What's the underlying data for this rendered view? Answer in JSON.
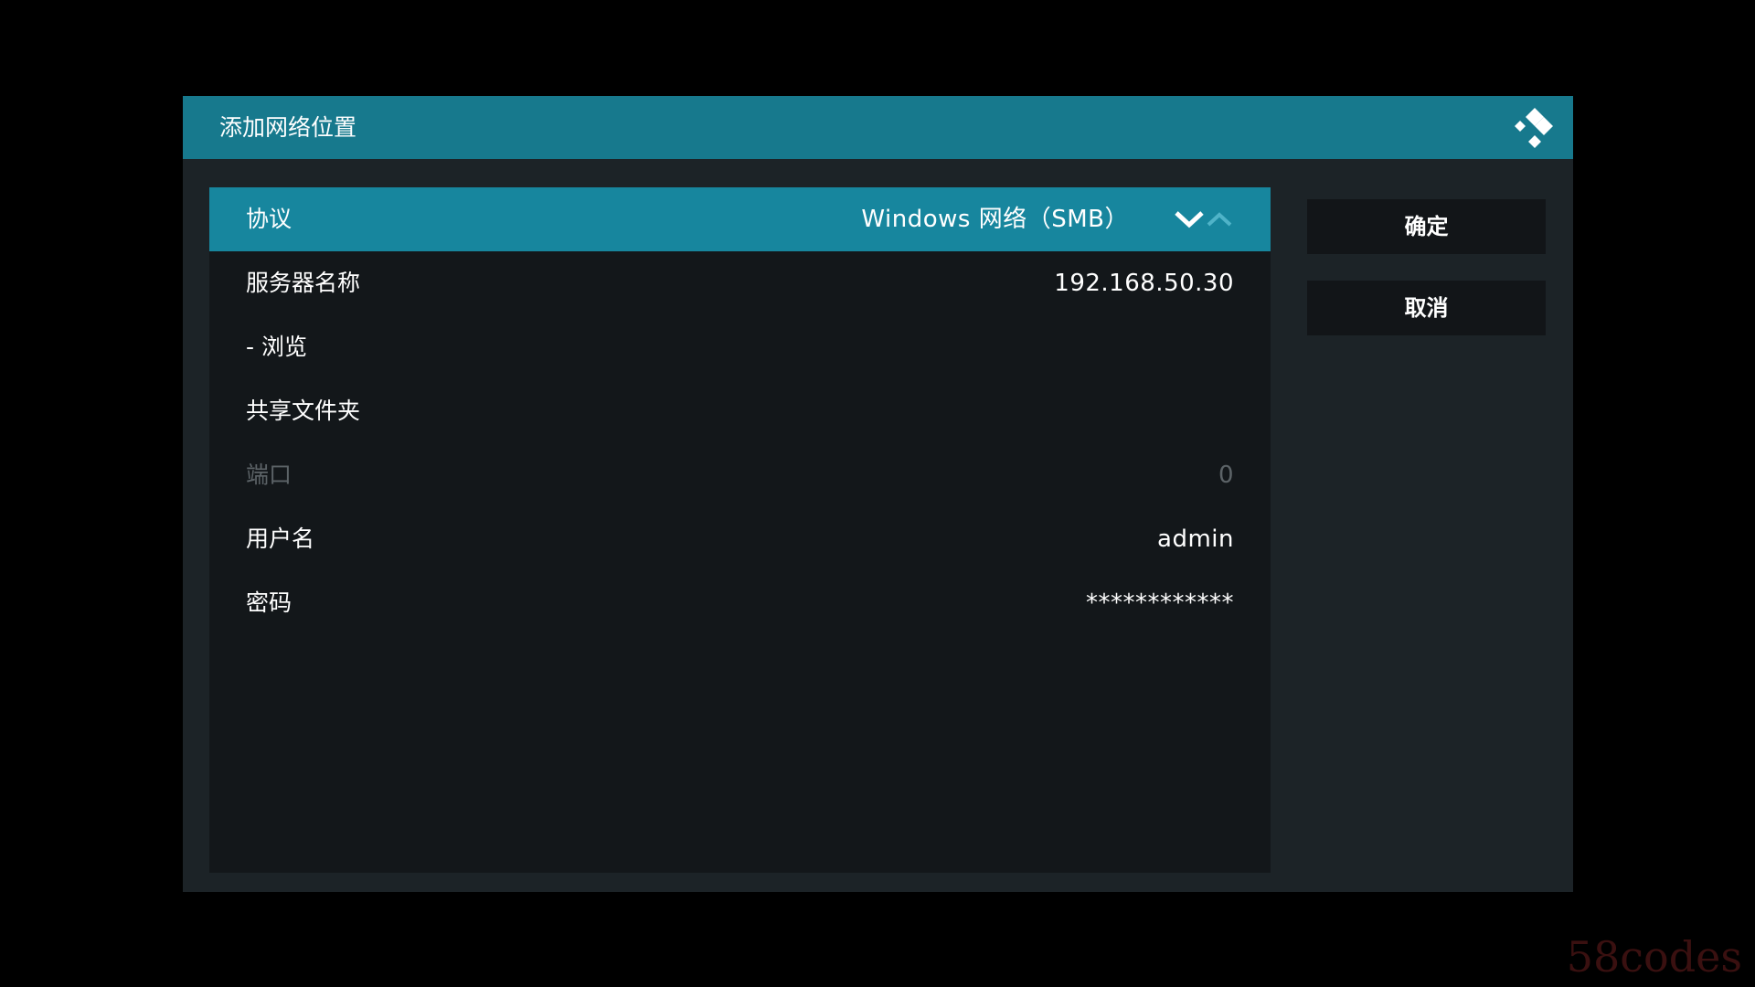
{
  "dialog": {
    "title": "添加网络位置",
    "logo_icon": "kodi-logo-icon"
  },
  "fields": [
    {
      "label": "协议",
      "value": "Windows 网络（SMB）",
      "focused": true,
      "disabled": false,
      "spinner": true
    },
    {
      "label": "服务器名称",
      "value": "192.168.50.30",
      "focused": false,
      "disabled": false
    },
    {
      "label": "- 浏览",
      "value": "",
      "focused": false,
      "disabled": false
    },
    {
      "label": "共享文件夹",
      "value": "",
      "focused": false,
      "disabled": false
    },
    {
      "label": "端口",
      "value": "0",
      "focused": false,
      "disabled": true
    },
    {
      "label": "用户名",
      "value": "admin",
      "focused": false,
      "disabled": false
    },
    {
      "label": "密码",
      "value": "************",
      "focused": false,
      "disabled": false
    }
  ],
  "buttons": {
    "ok_label": "确定",
    "cancel_label": "取消"
  },
  "icons": {
    "spin_down": "chevron-down-icon",
    "spin_up": "chevron-up-icon"
  },
  "watermark": "58codes",
  "colors": {
    "header": "#17798d",
    "focused_row": "#17869e",
    "dialog_bg": "#1c2327",
    "list_bg": "#13171a",
    "button_bg": "#121518"
  }
}
